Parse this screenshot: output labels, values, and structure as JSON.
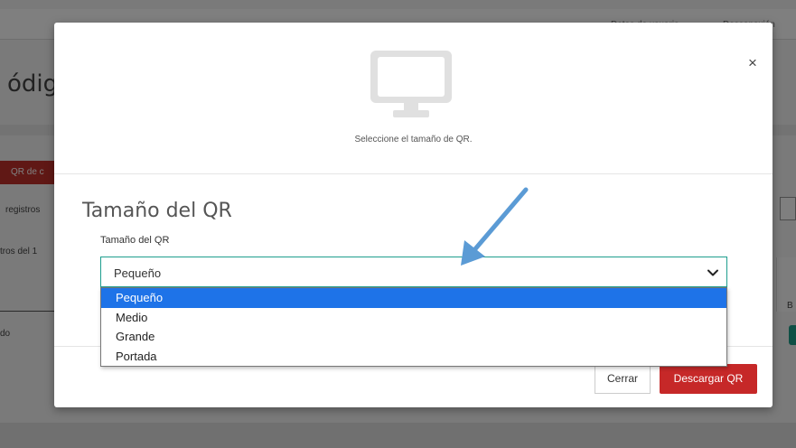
{
  "background": {
    "top_links": [
      "Datos de usuario",
      "Desconexión"
    ],
    "page_title_fragment": "ódigo",
    "red_button_fragment": "QR de c",
    "registros_label": "registros",
    "status_fragment": "tros del 1",
    "row_fragment": "do",
    "column_fragment": "B",
    "colon": ":"
  },
  "modal": {
    "header_caption": "Seleccione el tamaño de QR.",
    "close_label": "×",
    "section_title": "Tamaño del QR",
    "field_label": "Tamaño del QR",
    "select_value": "Pequeño",
    "options": [
      "Pequeño",
      "Medio",
      "Grande",
      "Portada"
    ],
    "selected_index": 0,
    "buttons": {
      "close": "Cerrar",
      "download": "Descargar QR"
    }
  },
  "colors": {
    "accent_red": "#c62828",
    "select_border": "#1e9e8e",
    "option_highlight": "#1e73e8",
    "annotation_arrow": "#5b9bd5"
  },
  "icons": {
    "monitor": "monitor-icon",
    "close": "close-icon",
    "chevron": "chevron-down-icon",
    "arrow": "annotation-arrow-icon"
  }
}
